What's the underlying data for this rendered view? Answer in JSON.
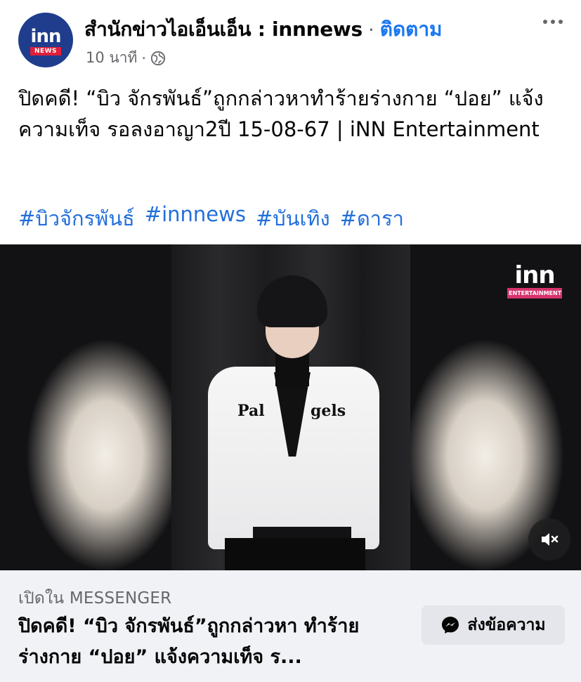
{
  "post": {
    "page_name": "สำนักข่าวไอเอ็นเอ็น : innnews",
    "separator": "·",
    "follow_label": "ติดตาม",
    "time": "10 นาที",
    "meta_separator": "·",
    "privacy_icon": "globe-icon",
    "avatar": {
      "logo_text": "inn",
      "logo_sub": "NEWS"
    },
    "text": "ปิดคดี! “บิว จักรพันธ์”ถูกกล่าวหาทำร้ายร่างกาย “ปอย” แจ้งความเท็จ รอลงอาญา2ปี 15-08-67 | iNN Entertainment",
    "hashtags": [
      "#บิวจักรพันธ์",
      "#innnews",
      "#บันเทิง",
      "#ดารา"
    ]
  },
  "video": {
    "overlay_logo": "inn",
    "overlay_logo_sub": "ENTERTAINMENT",
    "shirt_text_left": "Pal",
    "shirt_text_right": "gels",
    "mute_icon": "speaker-muted-icon"
  },
  "link_card": {
    "label": "เปิดใน MESSENGER",
    "title": "ปิดคดี! “บิว จักรพันธ์”ถูกกล่าวหา ทำร้ายร่างกาย “ปอย” แจ้งความเท็จ ร...",
    "button_label": "ส่งข้อความ",
    "button_icon": "messenger-icon"
  },
  "colors": {
    "link_blue": "#1877f2",
    "hashtag_blue": "#216fdb",
    "secondary_text": "#65676b",
    "card_bg": "#f0f2f5",
    "button_bg": "#e4e6eb"
  }
}
